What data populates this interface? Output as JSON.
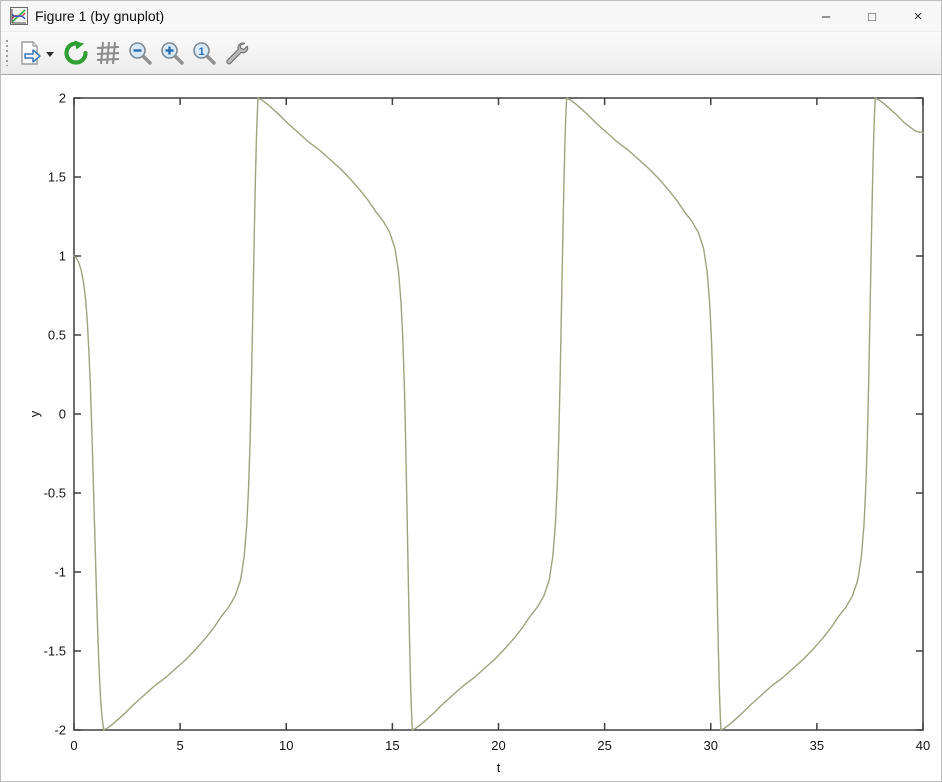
{
  "titlebar": {
    "title": "Figure 1 (by gnuplot)",
    "app_icon": "gnuplot-mini-chart-icon",
    "controls": {
      "minimize": "–",
      "maximize": "□",
      "close": "×"
    }
  },
  "toolbar": {
    "buttons": [
      {
        "name": "export-plot-button",
        "icon": "export-page-icon",
        "has_dropdown": true
      },
      {
        "name": "replot-button",
        "icon": "refresh-icon"
      },
      {
        "name": "toggle-grid-button",
        "icon": "grid-icon"
      },
      {
        "name": "zoom-previous-button",
        "icon": "zoom-out-icon"
      },
      {
        "name": "zoom-next-button",
        "icon": "zoom-in-icon"
      },
      {
        "name": "zoom-initial-button",
        "icon": "zoom-reset-1-icon"
      },
      {
        "name": "configure-button",
        "icon": "wrench-icon"
      }
    ]
  },
  "colors": {
    "line": "#9aa47e",
    "axis": "#3f3f3f",
    "refresh_green": "#2f9e33",
    "magnifier_blue": "#2a6fb0"
  },
  "chart_data": {
    "type": "line",
    "title": "",
    "xlabel": "t",
    "ylabel": "y",
    "xlim": [
      0,
      40
    ],
    "ylim": [
      -2,
      2
    ],
    "grid": false,
    "legend": null,
    "x_tick_values": [
      0,
      5,
      10,
      15,
      20,
      25,
      30,
      35,
      40
    ],
    "x_tick_labels": [
      "0",
      "5",
      "10",
      "15",
      "20",
      "25",
      "30",
      "35",
      "40"
    ],
    "y_tick_values": [
      -2,
      -1.5,
      -1,
      -0.5,
      0,
      0.5,
      1,
      1.5,
      2
    ],
    "y_tick_labels": [
      "-2",
      "-1.5",
      "-1",
      "-0.5",
      "0",
      "0.5",
      "1",
      "1.5",
      "2"
    ],
    "line_color": "#9aa47e",
    "series": [
      {
        "points": [
          [
            0.0,
            1.0
          ],
          [
            0.1,
            0.99
          ],
          [
            0.22,
            0.96
          ],
          [
            0.34,
            0.91
          ],
          [
            0.45,
            0.83
          ],
          [
            0.55,
            0.72
          ],
          [
            0.63,
            0.58
          ],
          [
            0.7,
            0.4
          ],
          [
            0.77,
            0.18
          ],
          [
            0.83,
            -0.06
          ],
          [
            0.89,
            -0.33
          ],
          [
            0.95,
            -0.62
          ],
          [
            1.01,
            -0.9
          ],
          [
            1.07,
            -1.18
          ],
          [
            1.13,
            -1.43
          ],
          [
            1.19,
            -1.64
          ],
          [
            1.26,
            -1.82
          ],
          [
            1.33,
            -1.93
          ],
          [
            1.4,
            -2.0
          ],
          [
            1.55,
            -1.99
          ],
          [
            1.85,
            -1.96
          ],
          [
            2.35,
            -1.9
          ],
          [
            2.8,
            -1.84
          ],
          [
            3.3,
            -1.78
          ],
          [
            3.8,
            -1.72
          ],
          [
            4.3,
            -1.67
          ],
          [
            4.8,
            -1.61
          ],
          [
            5.3,
            -1.55
          ],
          [
            5.8,
            -1.48
          ],
          [
            6.25,
            -1.41
          ],
          [
            6.6,
            -1.35
          ],
          [
            6.95,
            -1.28
          ],
          [
            7.3,
            -1.22
          ],
          [
            7.6,
            -1.15
          ],
          [
            7.85,
            -1.05
          ],
          [
            8.02,
            -0.9
          ],
          [
            8.14,
            -0.7
          ],
          [
            8.23,
            -0.45
          ],
          [
            8.3,
            -0.15
          ],
          [
            8.36,
            0.2
          ],
          [
            8.41,
            0.55
          ],
          [
            8.46,
            0.9
          ],
          [
            8.51,
            1.25
          ],
          [
            8.55,
            1.5
          ],
          [
            8.59,
            1.72
          ],
          [
            8.63,
            1.88
          ],
          [
            8.67,
            2.0
          ],
          [
            8.82,
            1.99
          ],
          [
            9.12,
            1.96
          ],
          [
            9.62,
            1.9
          ],
          [
            10.07,
            1.84
          ],
          [
            10.57,
            1.78
          ],
          [
            11.07,
            1.72
          ],
          [
            11.57,
            1.67
          ],
          [
            12.07,
            1.61
          ],
          [
            12.57,
            1.55
          ],
          [
            13.07,
            1.48
          ],
          [
            13.52,
            1.41
          ],
          [
            13.87,
            1.35
          ],
          [
            14.22,
            1.28
          ],
          [
            14.57,
            1.22
          ],
          [
            14.87,
            1.15
          ],
          [
            15.12,
            1.05
          ],
          [
            15.29,
            0.9
          ],
          [
            15.41,
            0.7
          ],
          [
            15.5,
            0.45
          ],
          [
            15.57,
            0.15
          ],
          [
            15.63,
            -0.2
          ],
          [
            15.68,
            -0.55
          ],
          [
            15.73,
            -0.9
          ],
          [
            15.78,
            -1.25
          ],
          [
            15.82,
            -1.5
          ],
          [
            15.86,
            -1.72
          ],
          [
            15.9,
            -1.88
          ],
          [
            15.94,
            -2.0
          ],
          [
            16.09,
            -1.99
          ],
          [
            16.39,
            -1.96
          ],
          [
            16.89,
            -1.9
          ],
          [
            17.34,
            -1.84
          ],
          [
            17.84,
            -1.78
          ],
          [
            18.34,
            -1.72
          ],
          [
            18.84,
            -1.67
          ],
          [
            19.34,
            -1.61
          ],
          [
            19.84,
            -1.55
          ],
          [
            20.34,
            -1.48
          ],
          [
            20.79,
            -1.41
          ],
          [
            21.14,
            -1.35
          ],
          [
            21.49,
            -1.28
          ],
          [
            21.84,
            -1.22
          ],
          [
            22.14,
            -1.15
          ],
          [
            22.39,
            -1.05
          ],
          [
            22.56,
            -0.9
          ],
          [
            22.68,
            -0.7
          ],
          [
            22.77,
            -0.45
          ],
          [
            22.84,
            -0.15
          ],
          [
            22.9,
            0.2
          ],
          [
            22.95,
            0.55
          ],
          [
            23.0,
            0.9
          ],
          [
            23.05,
            1.25
          ],
          [
            23.09,
            1.5
          ],
          [
            23.13,
            1.72
          ],
          [
            23.17,
            1.88
          ],
          [
            23.21,
            2.0
          ],
          [
            23.36,
            1.99
          ],
          [
            23.66,
            1.96
          ],
          [
            24.16,
            1.9
          ],
          [
            24.61,
            1.84
          ],
          [
            25.11,
            1.78
          ],
          [
            25.61,
            1.72
          ],
          [
            26.11,
            1.67
          ],
          [
            26.61,
            1.61
          ],
          [
            27.11,
            1.55
          ],
          [
            27.61,
            1.48
          ],
          [
            28.06,
            1.41
          ],
          [
            28.41,
            1.35
          ],
          [
            28.76,
            1.28
          ],
          [
            29.11,
            1.22
          ],
          [
            29.41,
            1.15
          ],
          [
            29.66,
            1.05
          ],
          [
            29.83,
            0.9
          ],
          [
            29.95,
            0.7
          ],
          [
            30.04,
            0.45
          ],
          [
            30.11,
            0.15
          ],
          [
            30.17,
            -0.2
          ],
          [
            30.22,
            -0.55
          ],
          [
            30.27,
            -0.9
          ],
          [
            30.32,
            -1.25
          ],
          [
            30.36,
            -1.5
          ],
          [
            30.4,
            -1.72
          ],
          [
            30.44,
            -1.88
          ],
          [
            30.48,
            -2.0
          ],
          [
            30.63,
            -1.99
          ],
          [
            30.93,
            -1.96
          ],
          [
            31.43,
            -1.9
          ],
          [
            31.88,
            -1.84
          ],
          [
            32.38,
            -1.78
          ],
          [
            32.88,
            -1.72
          ],
          [
            33.38,
            -1.67
          ],
          [
            33.88,
            -1.61
          ],
          [
            34.38,
            -1.55
          ],
          [
            34.88,
            -1.48
          ],
          [
            35.33,
            -1.41
          ],
          [
            35.68,
            -1.35
          ],
          [
            36.03,
            -1.28
          ],
          [
            36.38,
            -1.22
          ],
          [
            36.68,
            -1.15
          ],
          [
            36.93,
            -1.05
          ],
          [
            37.1,
            -0.9
          ],
          [
            37.22,
            -0.7
          ],
          [
            37.31,
            -0.45
          ],
          [
            37.38,
            -0.15
          ],
          [
            37.44,
            0.2
          ],
          [
            37.49,
            0.55
          ],
          [
            37.54,
            0.9
          ],
          [
            37.59,
            1.25
          ],
          [
            37.63,
            1.5
          ],
          [
            37.67,
            1.72
          ],
          [
            37.71,
            1.88
          ],
          [
            37.75,
            2.0
          ],
          [
            37.9,
            1.99
          ],
          [
            38.2,
            1.96
          ],
          [
            38.7,
            1.9
          ],
          [
            39.15,
            1.84
          ],
          [
            39.65,
            1.79
          ],
          [
            40.0,
            1.78
          ]
        ]
      }
    ]
  }
}
